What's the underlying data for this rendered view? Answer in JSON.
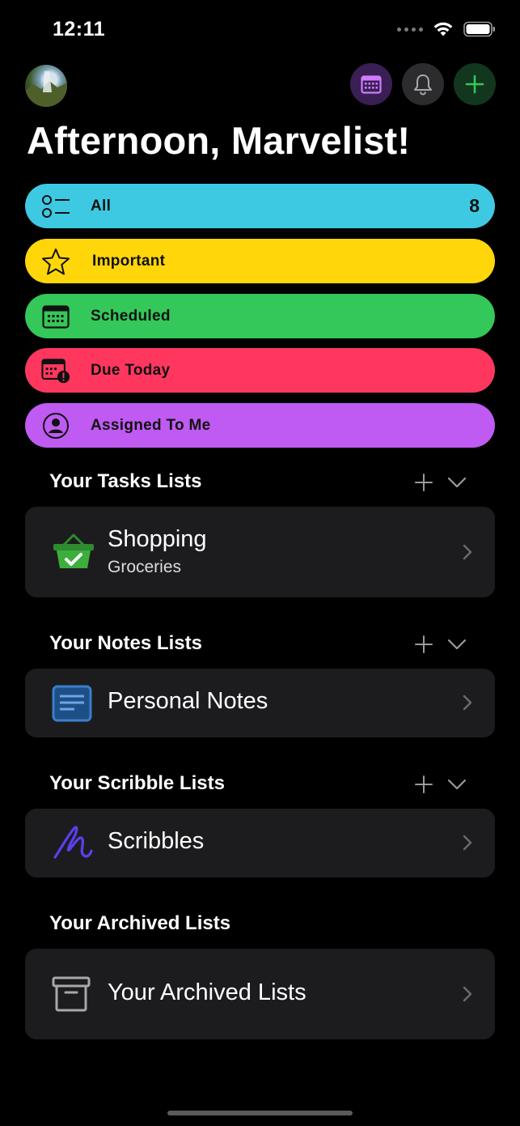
{
  "status": {
    "time": "12:11"
  },
  "header": {
    "avatar_icon": "profile-photo",
    "calendar_icon": "calendar-icon",
    "bell_icon": "bell-icon",
    "add_icon": "plus-icon"
  },
  "greeting": "Afternoon, Marvelist!",
  "smart_lists": [
    {
      "label": "All",
      "count": "8",
      "color": "#3ec9e3",
      "icon": "list-icon"
    },
    {
      "label": "Important",
      "color": "#ffd60a",
      "icon": "star-icon"
    },
    {
      "label": "Scheduled",
      "color": "#34c759",
      "icon": "calendar-icon"
    },
    {
      "label": "Due Today",
      "color": "#ff375f",
      "icon": "calendar-alert-icon"
    },
    {
      "label": "Assigned To Me",
      "color": "#bf5af2",
      "icon": "person-icon"
    }
  ],
  "sections": {
    "tasks": {
      "title": "Your Tasks Lists",
      "list": {
        "title": "Shopping",
        "subtitle": "Groceries",
        "icon": "basket-icon"
      }
    },
    "notes": {
      "title": "Your Notes Lists",
      "list": {
        "title": "Personal Notes",
        "icon": "note-icon"
      }
    },
    "scribbles": {
      "title": "Your Scribble Lists",
      "list": {
        "title": "Scribbles",
        "icon": "scribble-icon"
      }
    },
    "archived": {
      "title": "Your Archived Lists",
      "list": {
        "title": "Your Archived Lists",
        "icon": "archive-icon"
      }
    }
  }
}
